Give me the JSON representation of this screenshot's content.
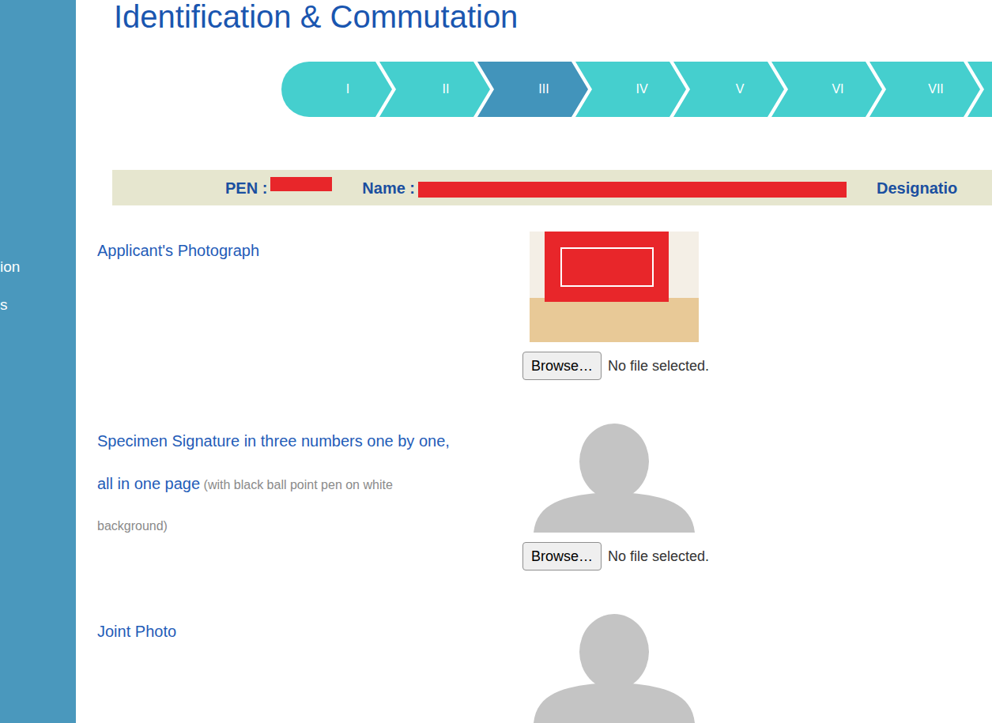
{
  "sidebar": {
    "items": [
      {
        "label": "ion"
      },
      {
        "label": "s"
      }
    ]
  },
  "page": {
    "title": "Identification & Commutation"
  },
  "steps": [
    {
      "label": "I",
      "selected": false
    },
    {
      "label": "II",
      "selected": false
    },
    {
      "label": "III",
      "selected": true
    },
    {
      "label": "IV",
      "selected": false
    },
    {
      "label": "V",
      "selected": false
    },
    {
      "label": "VI",
      "selected": false
    },
    {
      "label": "VII",
      "selected": false
    },
    {
      "label": "",
      "selected": false
    }
  ],
  "progress": {
    "level": 0.687
  },
  "info_bar": {
    "fields": [
      {
        "label": "PEN :",
        "redacted": true
      },
      {
        "label": "Name :",
        "redacted": true
      },
      {
        "label": "Designatio",
        "redacted": false
      }
    ]
  },
  "uploads": [
    {
      "label_lines": [
        "Applicant's Photograph"
      ],
      "hint_lines": [],
      "image": "photo",
      "button": "Browse…",
      "status": "No file selected."
    },
    {
      "label_lines": [
        "Specimen Signature in three numbers one by one,",
        "all in one page"
      ],
      "hint_lines": [
        "(with black ball point pen on white",
        "background)"
      ],
      "image": "placeholder",
      "button": "Browse…",
      "status": "No file selected."
    },
    {
      "label_lines": [
        "Joint Photo"
      ],
      "hint_lines": [],
      "image": "placeholder",
      "button": "",
      "status": ""
    }
  ]
}
